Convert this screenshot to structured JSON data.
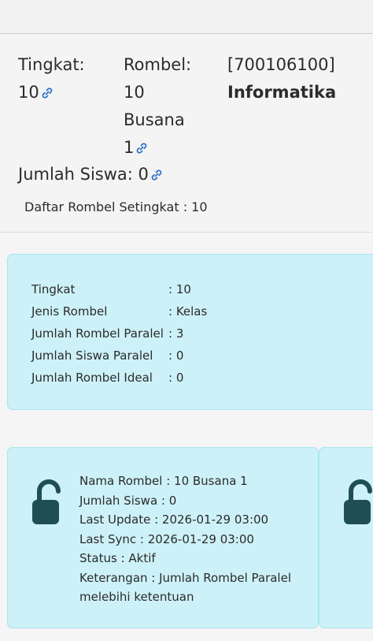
{
  "header": {
    "tingkat_label": "Tingkat:",
    "tingkat_value": "10",
    "rombel_label": "Rombel:",
    "rombel_line1": "10",
    "rombel_line2": "Busana",
    "rombel_line3": "1",
    "kode": "[700106100]",
    "mapel": "Informatika",
    "jumlah_siswa": "Jumlah Siswa: 0",
    "daftar_rombel": "Daftar Rombel Setingkat : 10"
  },
  "summary": {
    "rows": [
      {
        "key": "Tingkat",
        "value": ": 10"
      },
      {
        "key": "Jenis Rombel",
        "value": ": Kelas"
      },
      {
        "key": "Jumlah Rombel Paralel",
        "value": ": 3"
      },
      {
        "key": "Jumlah Siswa Paralel",
        "value": ": 0"
      },
      {
        "key": "Jumlah Rombel Ideal",
        "value": ": 0"
      }
    ]
  },
  "rombel_card": {
    "nama": "Nama Rombel : 10 Busana 1",
    "jumlah": "Jumlah Siswa : 0",
    "last_update": "Last Update : 2026-01-29 03:00",
    "last_sync": "Last Sync : 2026-01-29 03:00",
    "status": "Status : Aktif",
    "keterangan": "Keterangan : Jumlah Rombel Paralel melebihi ketentuan",
    "icon": "unlock-icon"
  },
  "colors": {
    "card_bg": "#cdf1f8",
    "card_border": "#a9e3ee",
    "icon": "#1f4f55",
    "link_icon": "#2b70c9"
  }
}
